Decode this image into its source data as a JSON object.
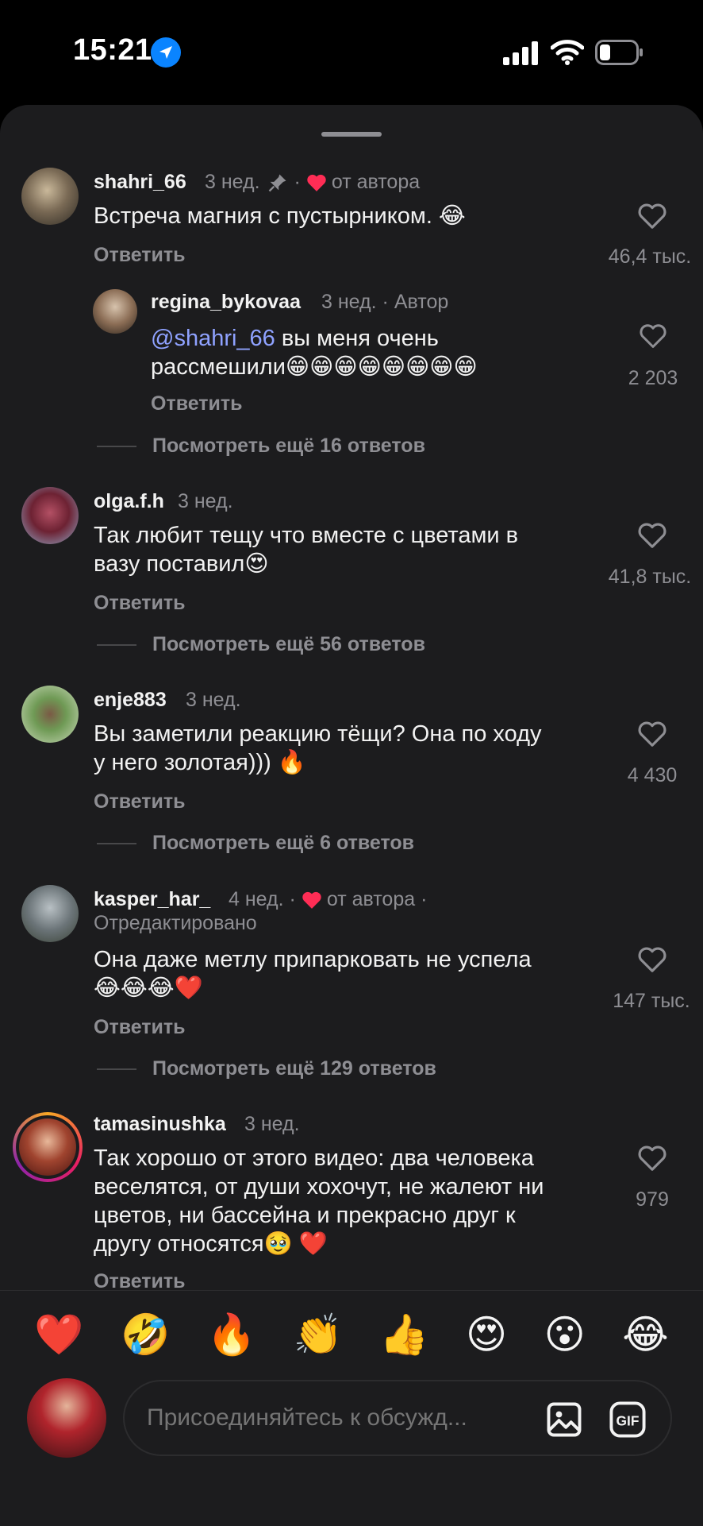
{
  "status": {
    "time": "15:21"
  },
  "composer": {
    "placeholder": "Присоединяйтесь к обсужд..."
  },
  "quick_emojis": [
    "❤️",
    "🤣",
    "🔥",
    "👏",
    "👍",
    "😍",
    "😮",
    "😂"
  ],
  "comments": [
    {
      "username": "shahri_66",
      "time": "3 нед.",
      "pinned": true,
      "liked_by_author": "от автора",
      "text": "Встреча магния с пустырником. 😂",
      "reply": "Ответить",
      "likes": "46,4 тыс."
    },
    {
      "username": "regina_bykovaa",
      "time": "3 нед.",
      "badge": "Автор",
      "mention": "@shahri_66",
      "text_line1": " вы меня очень",
      "text_line2": "рассмешили😁😁😁😁😁😁😁😁",
      "reply": "Ответить",
      "likes": "2 203"
    },
    {
      "more": "Посмотреть ещё 16 ответов"
    },
    {
      "username": "olga.f.h",
      "time": "3 нед.",
      "text_line1": "Так любит тещу что вместе с цветами в",
      "text_line2": "вазу поставил😍",
      "reply": "Ответить",
      "likes": "41,8 тыс."
    },
    {
      "more": "Посмотреть ещё 56 ответов"
    },
    {
      "username": "enje883",
      "time": "3 нед.",
      "text_line1": "Вы заметили реакцию тёщи? Она по ходу",
      "text_line2": "у него  золотая))) 🔥",
      "reply": "Ответить",
      "likes": "4 430"
    },
    {
      "more": "Посмотреть ещё 6 ответов"
    },
    {
      "username": "kasper_har_",
      "time": "4 нед.",
      "liked_by_author": "от автора",
      "edited": "Отредактировано",
      "text_line1": "Она даже метлу  припарковать не успела",
      "text_line2": "😂😂😂❤️",
      "reply": "Ответить",
      "likes": "147 тыс."
    },
    {
      "more": "Посмотреть ещё 129 ответов"
    },
    {
      "username": "tamasinushka",
      "time": "3 нед.",
      "text_line1": "Так хорошо от этого видео: два человека",
      "text_line2": "веселятся, от души хохочут, не жалеют ни",
      "text_line3": "цветов, ни бассейна и прекрасно друг к",
      "text_line4": "другу относятся🥹 ❤️",
      "reply": "Ответить",
      "likes": "979"
    }
  ]
}
